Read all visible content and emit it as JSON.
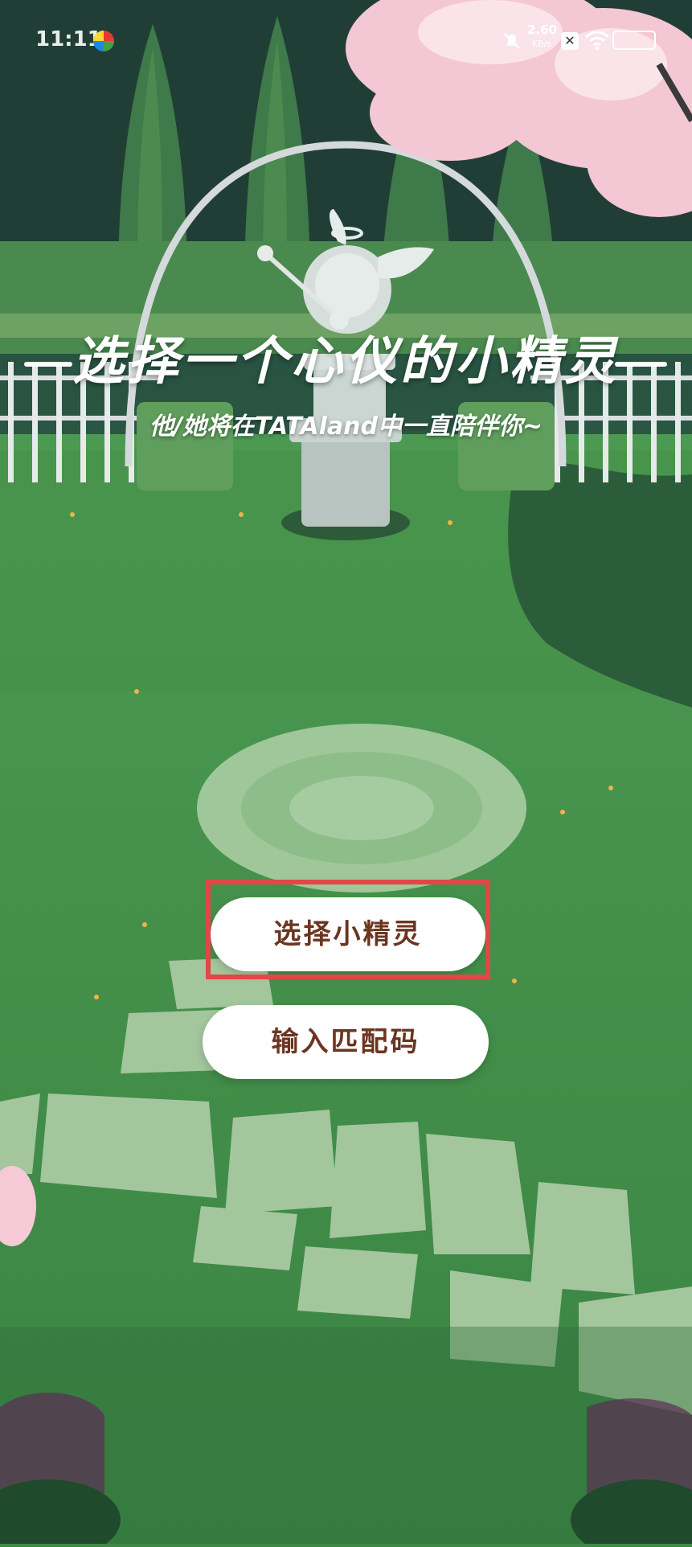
{
  "status_bar": {
    "time": "11:11",
    "network_speed_value": "2.60",
    "network_speed_unit": "KB/s",
    "sim_label": "✕",
    "icons": [
      "app-notification-icon",
      "mute-icon",
      "sim-icon",
      "wifi-icon",
      "battery-icon"
    ]
  },
  "main": {
    "title": "选择一个心仪的小精灵",
    "subtitle": "他/她将在TATAland中一直陪伴你~"
  },
  "actions": {
    "select_label": "选择小精灵",
    "code_label": "输入匹配码"
  },
  "colors": {
    "button_text": "#6b3520",
    "highlight": "#e24646",
    "grass": "#3d8a45"
  }
}
